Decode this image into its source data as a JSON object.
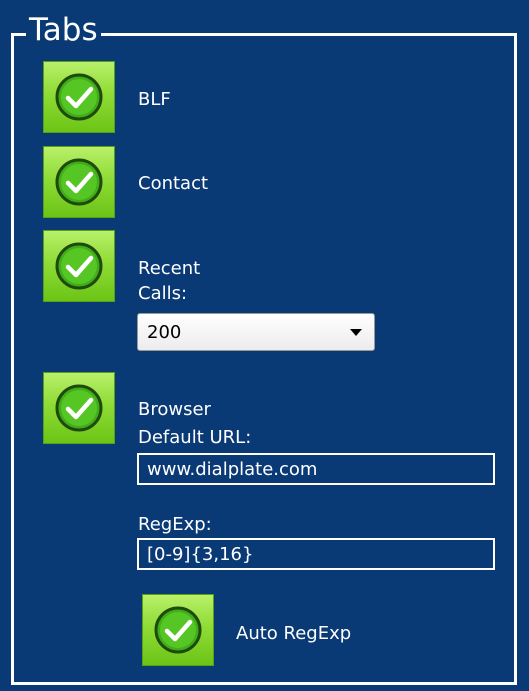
{
  "section": {
    "legend": "Tabs"
  },
  "tabs": {
    "blf": {
      "label": "BLF",
      "checked": true
    },
    "contact": {
      "label": "Contact",
      "checked": true
    },
    "recent_calls": {
      "label_line1": "Recent",
      "label_line2": "Calls:",
      "checked": true,
      "select_value": "200"
    },
    "browser": {
      "label_line1": "Browser",
      "label_line2": "Default URL:",
      "checked": true,
      "url_value": "www.dialplate.com",
      "regexp_label": "RegExp:",
      "regexp_value": "[0-9]{3,16}",
      "auto_regexp_label": "Auto RegExp",
      "auto_regexp_checked": true
    }
  },
  "colors": {
    "panel_background": "#0a3a76",
    "check_green": "#8fdc36",
    "text": "#ffffff"
  },
  "icons": {
    "checkbox": "check-circle-icon",
    "dropdown": "chevron-down-icon"
  }
}
